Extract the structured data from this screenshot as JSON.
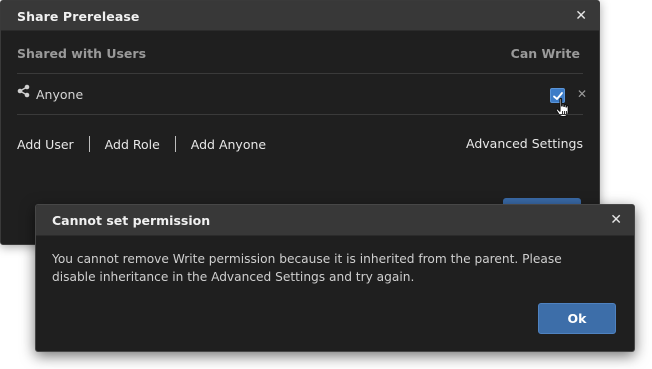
{
  "share_dialog": {
    "title": "Share Prerelease",
    "close_glyph": "✕",
    "columns": {
      "shared_with": "Shared with Users",
      "can_write": "Can Write"
    },
    "rows": [
      {
        "icon": "share-icon",
        "name": "Anyone",
        "can_write_checked": true,
        "remove_glyph": "✕"
      }
    ],
    "actions": [
      "Add User",
      "Add Role",
      "Add Anyone"
    ],
    "advanced_settings": "Advanced Settings"
  },
  "error_dialog": {
    "title": "Cannot set permission",
    "close_glyph": "✕",
    "message": "You cannot remove Write permission because it is inherited from the parent. Please disable inheritance in the Advanced Settings and try again.",
    "ok_label": "Ok"
  },
  "colors": {
    "accent": "#3d7cc7",
    "dialog_bg": "#1f1f1f",
    "titlebar_bg": "#383838"
  }
}
